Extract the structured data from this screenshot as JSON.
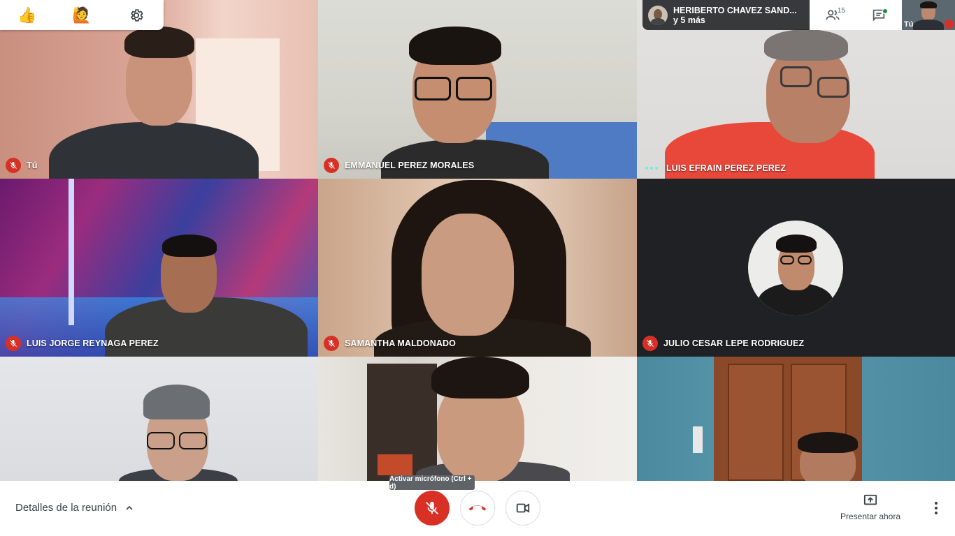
{
  "reactions": {
    "thumbs_up": "👍",
    "raise_hand": "🙋"
  },
  "presenter": {
    "line1": "HERIBERTO CHAVEZ SAND...",
    "line2": "y 5 más"
  },
  "top_actions": {
    "participants_count": "15"
  },
  "self_view": {
    "label": "Tú"
  },
  "tiles": [
    {
      "name": "Tú",
      "status": "muted"
    },
    {
      "name": "EMMANUEL PEREZ MORALES",
      "status": "muted"
    },
    {
      "name": "LUIS EFRAIN PEREZ PEREZ",
      "status": "speaking"
    },
    {
      "name": "LUIS JORGE REYNAGA PEREZ",
      "status": "muted"
    },
    {
      "name": "SAMANTHA MALDONADO",
      "status": "muted"
    },
    {
      "name": "JULIO CESAR LEPE RODRIGUEZ",
      "status": "muted"
    },
    {
      "name": "",
      "status": "none"
    },
    {
      "name": "",
      "status": "none"
    },
    {
      "name": "",
      "status": "none"
    }
  ],
  "tooltip": "Activar micrófono (Ctrl + d)",
  "bottom_bar": {
    "details_label": "Detalles de la reunión",
    "present_label": "Presentar ahora"
  },
  "colors": {
    "danger": "#d93025",
    "dark_bg": "#202124",
    "speaking": "#6df0e0"
  }
}
